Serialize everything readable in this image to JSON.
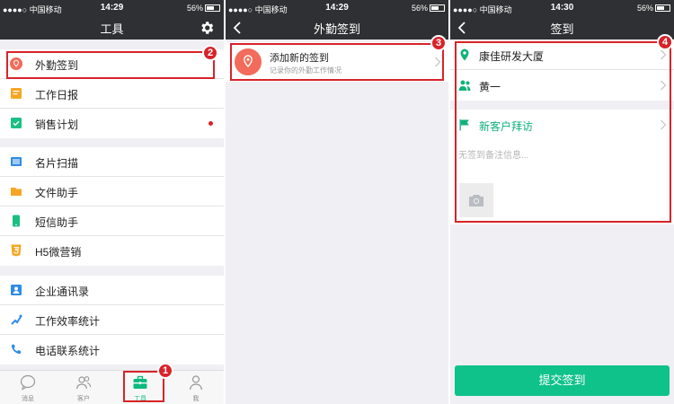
{
  "status_bar": {
    "carrier": "●●●●○ 中国移动",
    "battery": "56%",
    "left_time": "14:29",
    "middle_time": "14:29",
    "right_time": "14:30"
  },
  "tools_screen": {
    "title": "工具",
    "groups": [
      [
        {
          "label": "外勤签到",
          "icon": "location-pin-icon"
        },
        {
          "label": "工作日报",
          "icon": "report-icon"
        },
        {
          "label": "销售计划",
          "icon": "sales-plan-icon"
        }
      ],
      [
        {
          "label": "名片扫描",
          "icon": "scan-icon"
        },
        {
          "label": "文件助手",
          "icon": "folder-icon"
        },
        {
          "label": "短信助手",
          "icon": "phone-icon"
        },
        {
          "label": "H5微营销",
          "icon": "html5-icon"
        }
      ],
      [
        {
          "label": "企业通讯录",
          "icon": "contacts-icon"
        },
        {
          "label": "工作效率统计",
          "icon": "efficiency-icon"
        },
        {
          "label": "电话联系统计",
          "icon": "call-stats-icon"
        }
      ]
    ],
    "tabs": [
      "消息",
      "客户",
      "工具",
      "我"
    ],
    "active_tab": "工具"
  },
  "checkin_list_screen": {
    "title": "外勤签到",
    "add_title": "添加新的签到",
    "add_subtitle": "记录你的外勤工作情况"
  },
  "checkin_screen": {
    "title": "签到",
    "location": "康佳研发大厦",
    "person": "黄一",
    "visit_label": "新客户拜访",
    "note_placeholder": "无签到备注信息...",
    "submit_label": "提交签到"
  },
  "annotations": [
    "1",
    "2",
    "3",
    "4"
  ],
  "colors": {
    "accent_green": "#0fc28a",
    "highlight_red": "#d8232a",
    "nav_bg": "#2f3033"
  }
}
